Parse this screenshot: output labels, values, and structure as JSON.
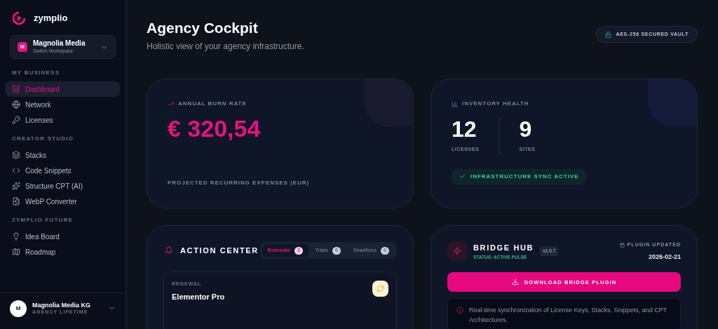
{
  "brand": "zymplio",
  "workspace": {
    "badge": "M",
    "name": "Magnolia Media",
    "hint": "Switch Workspace"
  },
  "sidebar": {
    "sections": [
      {
        "title": "MY BUSINESS",
        "items": [
          {
            "label": "Dashboard",
            "selected": true
          },
          {
            "label": "Network",
            "selected": false
          },
          {
            "label": "Licenses",
            "selected": false
          }
        ]
      },
      {
        "title": "CREATOR STUDIO",
        "items": [
          {
            "label": "Stacks",
            "selected": false
          },
          {
            "label": "Code Snippets",
            "selected": false
          },
          {
            "label": "Structure CPT (AI)",
            "selected": false
          },
          {
            "label": "WebP Converter",
            "selected": false
          }
        ]
      },
      {
        "title": "ZYMPLIO FUTURE",
        "items": [
          {
            "label": "Idea Board",
            "selected": false
          },
          {
            "label": "Roadmap",
            "selected": false
          }
        ]
      }
    ]
  },
  "account": {
    "avatar": "M",
    "name": "Magnolia Media KG",
    "plan": "AGENCY LIFETIME"
  },
  "header": {
    "title": "Agency Cockpit",
    "subtitle": "Holistic view of your agency infrastructure.",
    "vault_badge": "AES-256 SECURED VAULT"
  },
  "burn_rate": {
    "label": "ANNUAL BURN RATE",
    "value": "€ 320,54",
    "caption": "PROJECTED RECURRING EXPENSES (EUR)"
  },
  "inventory": {
    "label": "INVENTORY HEALTH",
    "stats": [
      {
        "value": "12",
        "label": "LICENSES"
      },
      {
        "value": "9",
        "label": "SITES"
      }
    ],
    "sync_badge": "INFRASTRUCTURE SYNC ACTIVE"
  },
  "action_center": {
    "title": "ACTION CENTER",
    "tabs": [
      {
        "label": "Renewals",
        "count": "2",
        "selected": true
      },
      {
        "label": "Trials",
        "count": "0",
        "selected": false
      },
      {
        "label": "Deadlines",
        "count": "0",
        "selected": false
      }
    ],
    "items": [
      {
        "type": "RENEWAL",
        "name": "Elementor Pro"
      }
    ]
  },
  "bridge_hub": {
    "title": "BRIDGE HUB",
    "status": "STATUS: ACTIVE PULSE",
    "version": "v1.0.7",
    "updated_label": "PLUGIN UPDATED",
    "updated_date": "2026-02-21",
    "download_button": "DOWNLOAD BRIDGE PLUGIN",
    "info": "Real-time synchronization of License Keys, Stacks, Snippets, and CPT Architectures."
  }
}
